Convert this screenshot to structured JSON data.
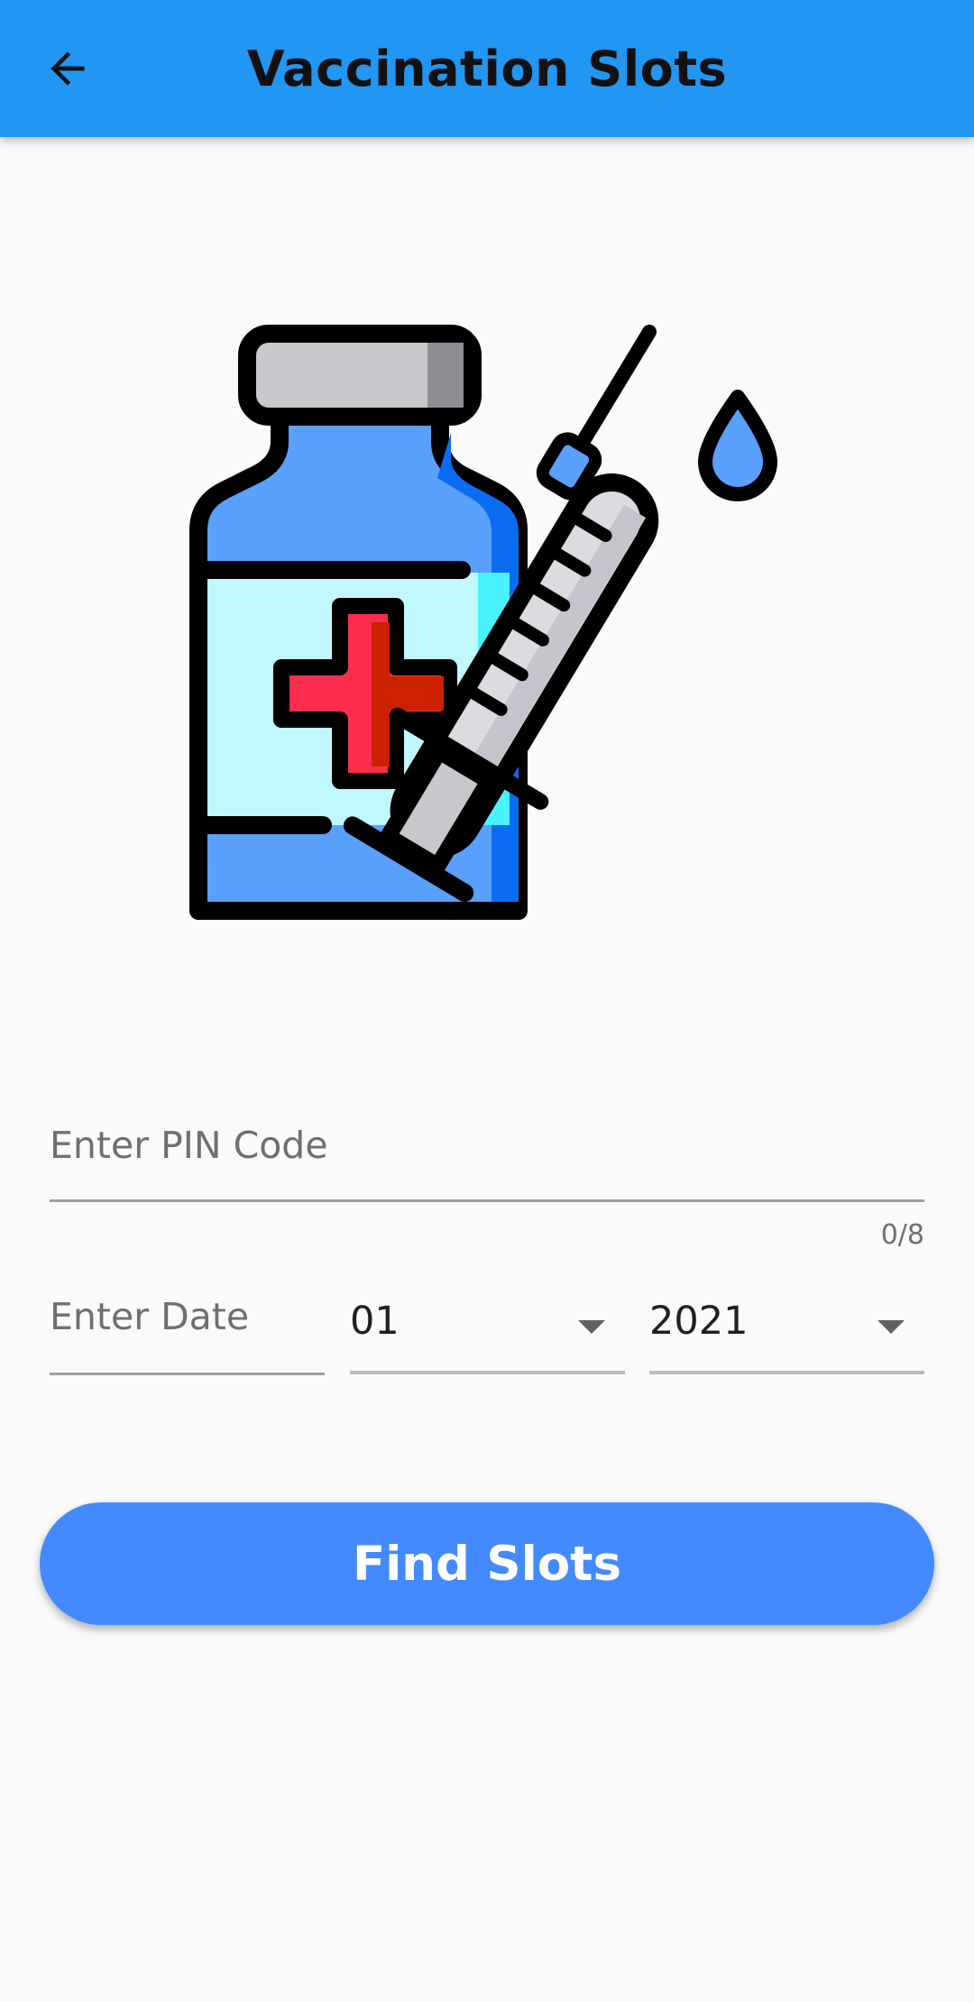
{
  "appbar": {
    "title": "Vaccination Slots",
    "back_icon": "arrow-back-icon",
    "background_color": "#2196f3"
  },
  "illustration": {
    "icon": "vaccine-vial-syringe-icon"
  },
  "pin_field": {
    "placeholder": "Enter PIN Code",
    "value": "",
    "counter": "0/8"
  },
  "date_field": {
    "placeholder": "Enter Date",
    "value": ""
  },
  "month_dropdown": {
    "selected": "01",
    "icon": "arrow-drop-down-icon"
  },
  "year_dropdown": {
    "selected": "2021",
    "icon": "arrow-drop-down-icon"
  },
  "find_button": {
    "label": "Find Slots",
    "color": "#448aff"
  }
}
